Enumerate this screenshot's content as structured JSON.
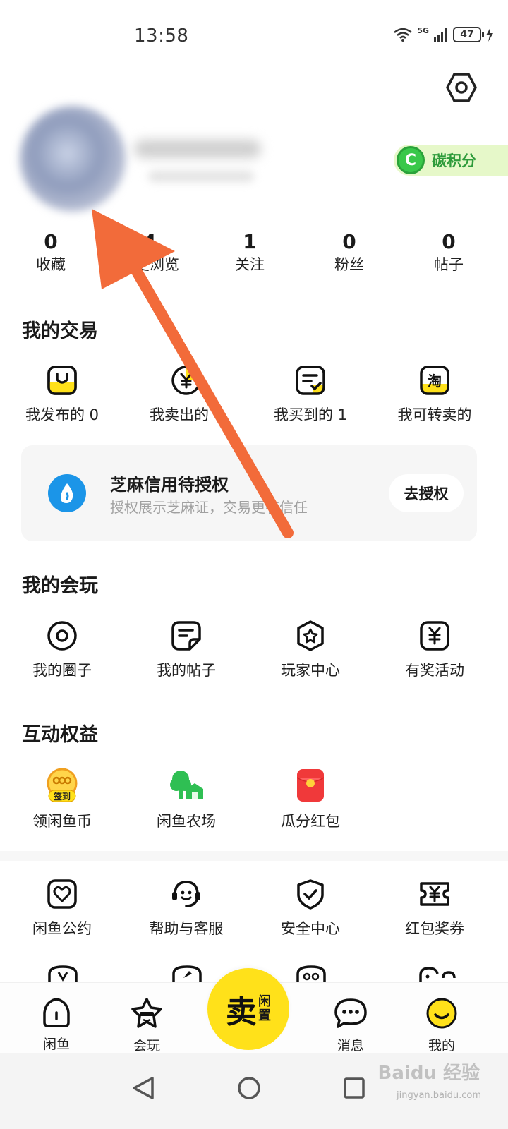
{
  "status_bar": {
    "time": "13:58",
    "network": "5G",
    "battery": "47"
  },
  "header": {
    "carbon_label": "碳积分",
    "carbon_icon_letter": "C"
  },
  "stats": [
    {
      "value": "0",
      "label": "收藏"
    },
    {
      "value": "4",
      "label": "历史浏览"
    },
    {
      "value": "1",
      "label": "关注"
    },
    {
      "value": "0",
      "label": "粉丝"
    },
    {
      "value": "0",
      "label": "帖子"
    }
  ],
  "trade": {
    "title": "我的交易",
    "items": [
      {
        "label": "我发布的 0",
        "icon": "bag-icon"
      },
      {
        "label": "我卖出的 0",
        "icon": "yuan-coin-icon"
      },
      {
        "label": "我买到的 1",
        "icon": "order-check-icon"
      },
      {
        "label": "我可转卖的",
        "icon": "taobao-icon"
      }
    ]
  },
  "sesame": {
    "title": "芝麻信用待授权",
    "subtitle": "授权展示芝麻证，交易更有信任",
    "button": "去授权"
  },
  "play": {
    "title": "我的会玩",
    "items": [
      {
        "label": "我的圈子",
        "icon": "circle-target-icon"
      },
      {
        "label": "我的帖子",
        "icon": "note-icon"
      },
      {
        "label": "玩家中心",
        "icon": "star-badge-icon"
      },
      {
        "label": "有奖活动",
        "icon": "yuan-ticket-icon"
      }
    ]
  },
  "benefits": {
    "title": "互动权益",
    "items": [
      {
        "label": "领闲鱼币",
        "icon": "checkin-coin-icon",
        "badge": "签到"
      },
      {
        "label": "闲鱼农场",
        "icon": "farm-icon"
      },
      {
        "label": "瓜分红包",
        "icon": "red-envelope-icon"
      }
    ]
  },
  "services": {
    "items": [
      {
        "label": "闲鱼公约",
        "icon": "heart-doc-icon"
      },
      {
        "label": "帮助与客服",
        "icon": "headset-face-icon"
      },
      {
        "label": "安全中心",
        "icon": "shield-check-icon"
      },
      {
        "label": "红包奖券",
        "icon": "coupon-icon"
      }
    ]
  },
  "bottom_nav": {
    "items": [
      {
        "label": "闲鱼",
        "icon": "home-icon"
      },
      {
        "label": "会玩",
        "icon": "star-face-icon"
      },
      {
        "label": "消息",
        "icon": "chat-icon"
      },
      {
        "label": "我的",
        "icon": "smiley-icon"
      }
    ],
    "sell_main": "卖",
    "sell_small_1": "闲",
    "sell_small_2": "置"
  },
  "watermark": {
    "text": "Baidu 经验",
    "sub": "jingyan.baidu.com"
  },
  "colors": {
    "brand_yellow": "#ffe11a",
    "annotation_orange": "#f26b3a",
    "carbon_green": "#39c84a",
    "sesame_blue": "#1b95e8"
  }
}
